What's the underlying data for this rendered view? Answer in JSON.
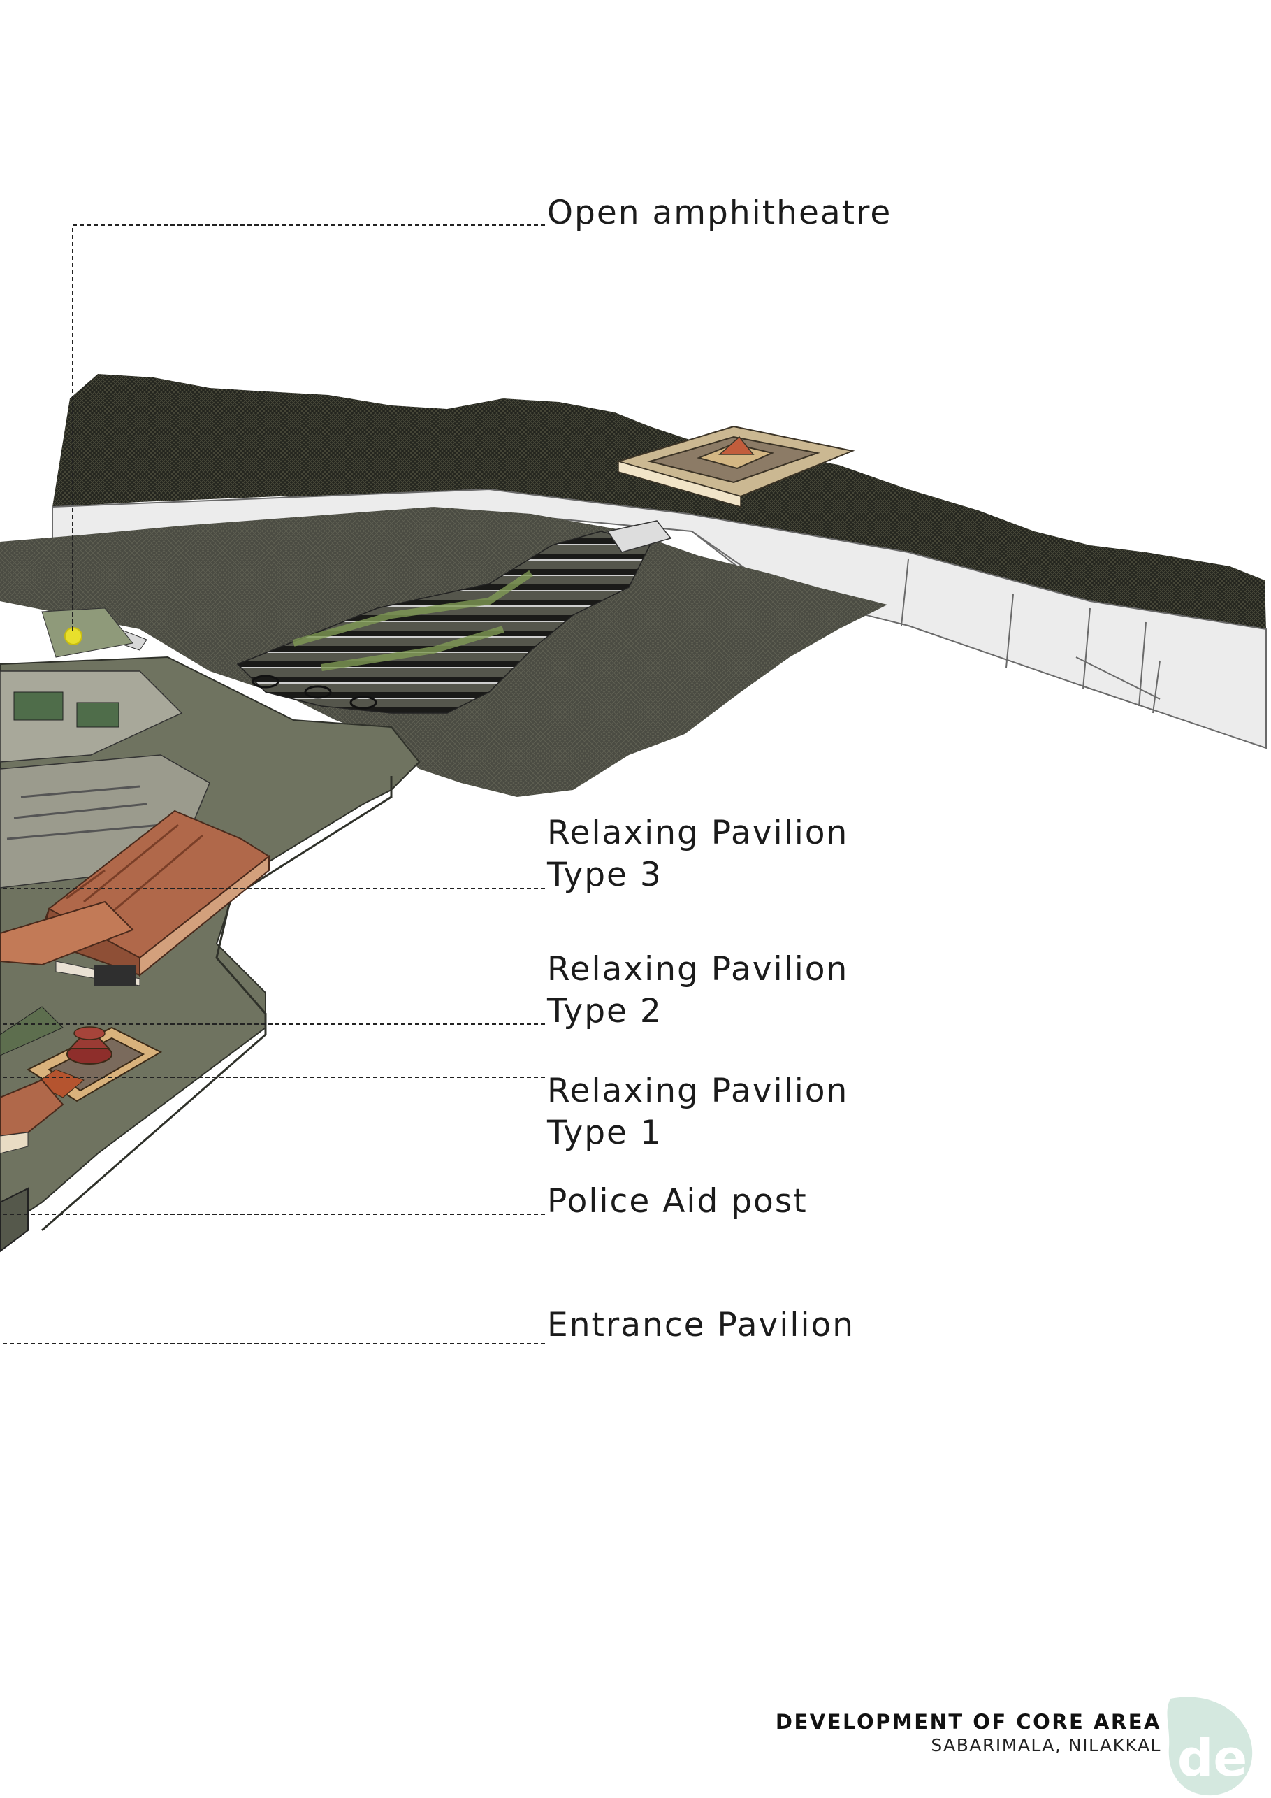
{
  "labels": {
    "open_amphitheatre": "Open amphitheatre",
    "relaxing_pavilion_3": [
      "Relaxing Pavilion",
      "Type 3"
    ],
    "relaxing_pavilion_2": [
      "Relaxing Pavilion",
      "Type 2"
    ],
    "relaxing_pavilion_1": [
      "Relaxing Pavilion",
      "Type 1"
    ],
    "police_aid_post": "Police Aid post",
    "entrance_pavilion": "Entrance Pavilion"
  },
  "title_block": {
    "title": "DEVELOPMENT OF CORE AREA",
    "subtitle": "SABARIMALA, NILAKKAL"
  },
  "logo": {
    "text": "de",
    "color": "#cfe5dc"
  },
  "colors": {
    "terrain_dark": "#1f1f1a",
    "terrain_mid": "#4a4b40",
    "platform": "#e4e4e4",
    "ground": "#6f7360",
    "roof": "#b0684a",
    "leader": "#222222"
  }
}
